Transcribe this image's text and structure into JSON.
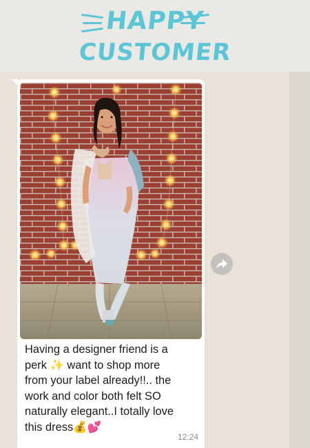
{
  "header": {
    "title_line1": "HAPPY",
    "title_line2": "CUSTOMER",
    "accent_color": "#5cc6d7"
  },
  "chat": {
    "message_lines": [
      "Having a designer friend is a",
      "perk ✨ want to shop more",
      "from your label already!!.. the",
      "work and color both felt SO",
      "naturally elegant..I totally love",
      "this dress💰💕"
    ],
    "time": "12:24",
    "bubble_color": "#ffffff",
    "background_color": "#e9e2d8",
    "forward_icon": "share-forward-icon"
  }
}
